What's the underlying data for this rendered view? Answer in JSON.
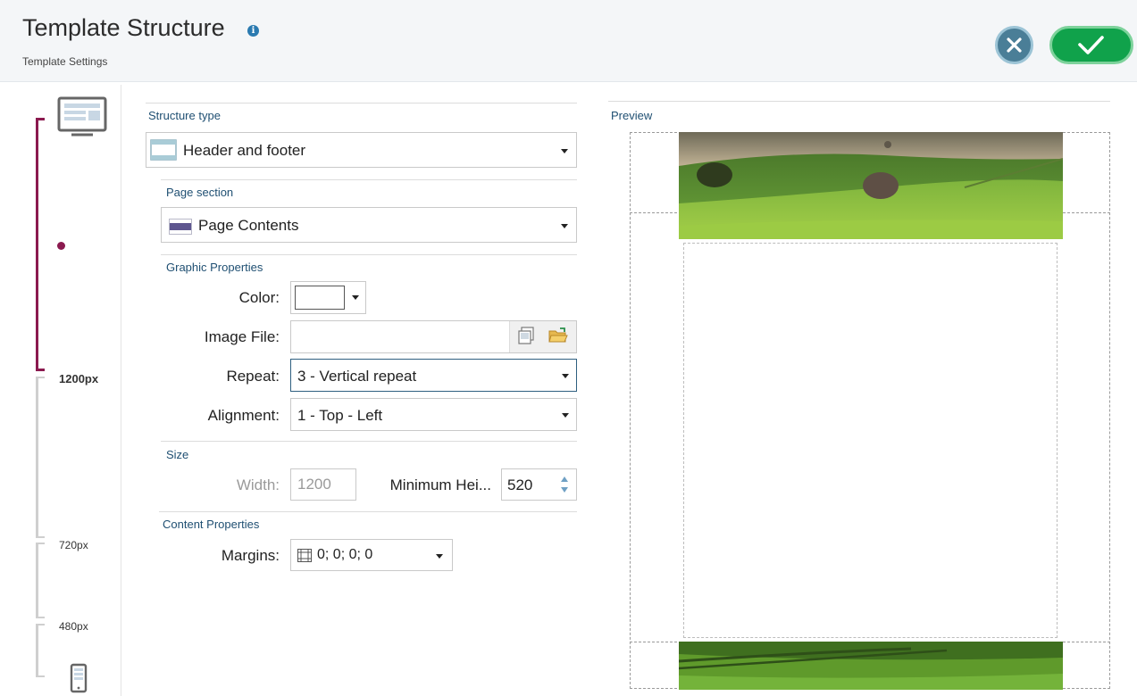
{
  "header": {
    "title": "Template Structure",
    "subtitle": "Template Settings",
    "info_icon": "i"
  },
  "rail": {
    "breakpoints": [
      "1200px",
      "720px",
      "480px"
    ],
    "accent_color": "#8b1a4f"
  },
  "form": {
    "structure_type": {
      "label": "Structure type",
      "value": "Header and footer"
    },
    "page_section": {
      "label": "Page section",
      "value": "Page Contents"
    },
    "graphic": {
      "label": "Graphic Properties",
      "color_label": "Color:",
      "image_file_label": "Image File:",
      "image_file_value": "",
      "repeat_label": "Repeat:",
      "repeat_value": "3 - Vertical repeat",
      "alignment_label": "Alignment:",
      "alignment_value": "1 - Top - Left"
    },
    "size": {
      "label": "Size",
      "width_label": "Width:",
      "width_value": "1200",
      "min_height_label": "Minimum Hei...",
      "min_height_value": "520"
    },
    "content": {
      "label": "Content Properties",
      "margins_label": "Margins:",
      "margins_value": "0; 0; 0; 0"
    }
  },
  "preview": {
    "label": "Preview"
  },
  "colors": {
    "accent_blue": "#1f4f72",
    "cancel": "#4a7e97",
    "confirm": "#10a24b"
  }
}
